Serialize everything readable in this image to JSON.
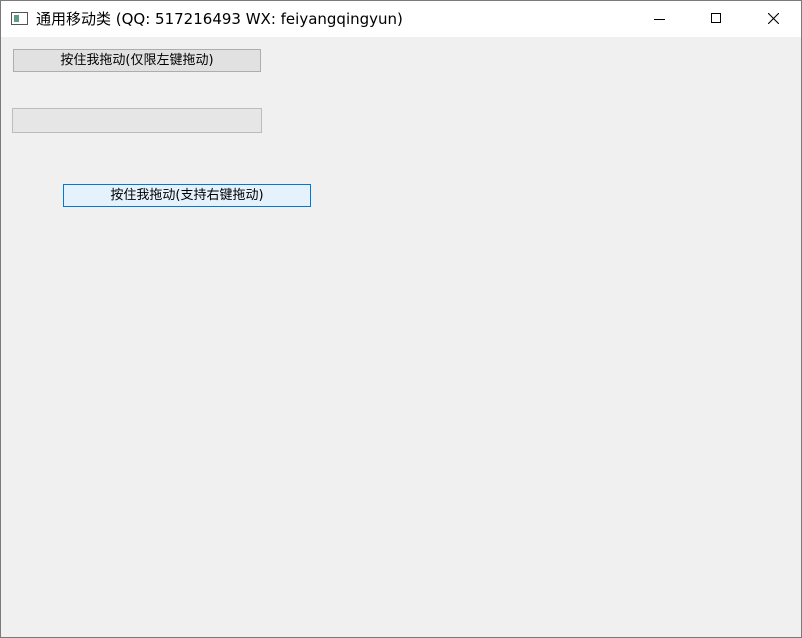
{
  "window": {
    "title": "通用移动类 (QQ: 517216493 WX: feiyangqingyun)",
    "icon": "app-window-icon"
  },
  "controls": {
    "button_left_drag_label": "按住我拖动(仅限左键拖动)",
    "button_right_drag_label": "按住我拖动(支持右键拖动)",
    "progress_value": 0
  },
  "colors": {
    "window_bg": "#f0f0f0",
    "titlebar_bg": "#ffffff",
    "button_bg": "#e1e1e1",
    "focused_button_border": "#0078d7",
    "focused_button_bg": "#e5f1fb"
  }
}
